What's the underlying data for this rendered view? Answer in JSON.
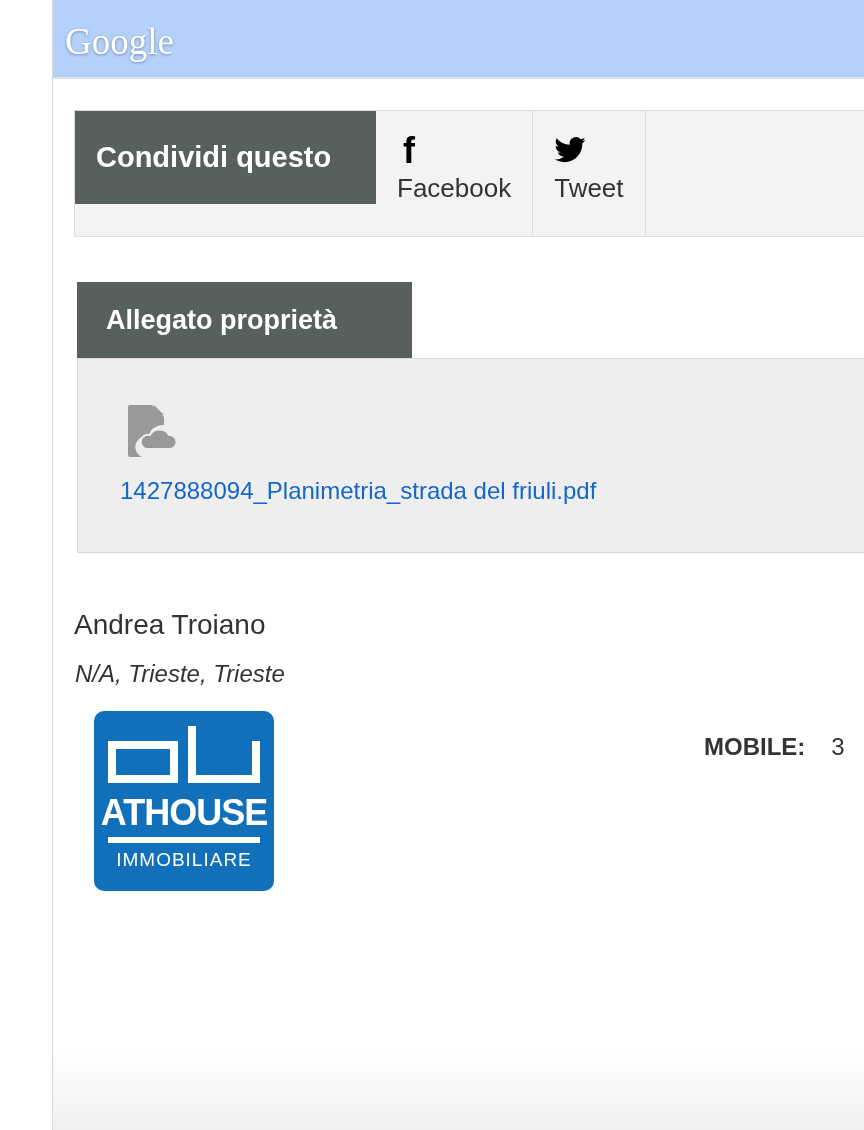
{
  "header": {
    "brand": "Google"
  },
  "share": {
    "title": "Condividi questo",
    "buttons": [
      {
        "kind": "facebook",
        "label": "Facebook",
        "glyph": "f"
      },
      {
        "kind": "twitter",
        "label": "Tweet"
      }
    ]
  },
  "attachment": {
    "title": "Allegato proprietà",
    "file": "1427888094_Planimetria_strada del friuli.pdf"
  },
  "agent": {
    "name": "Andrea Troiano",
    "location": "N/A, Trieste, Trieste",
    "logo": {
      "name": "ATHOUSE",
      "tagline": "IMMOBILIARE"
    },
    "phone_label": "MOBILE:",
    "phone": "3"
  }
}
